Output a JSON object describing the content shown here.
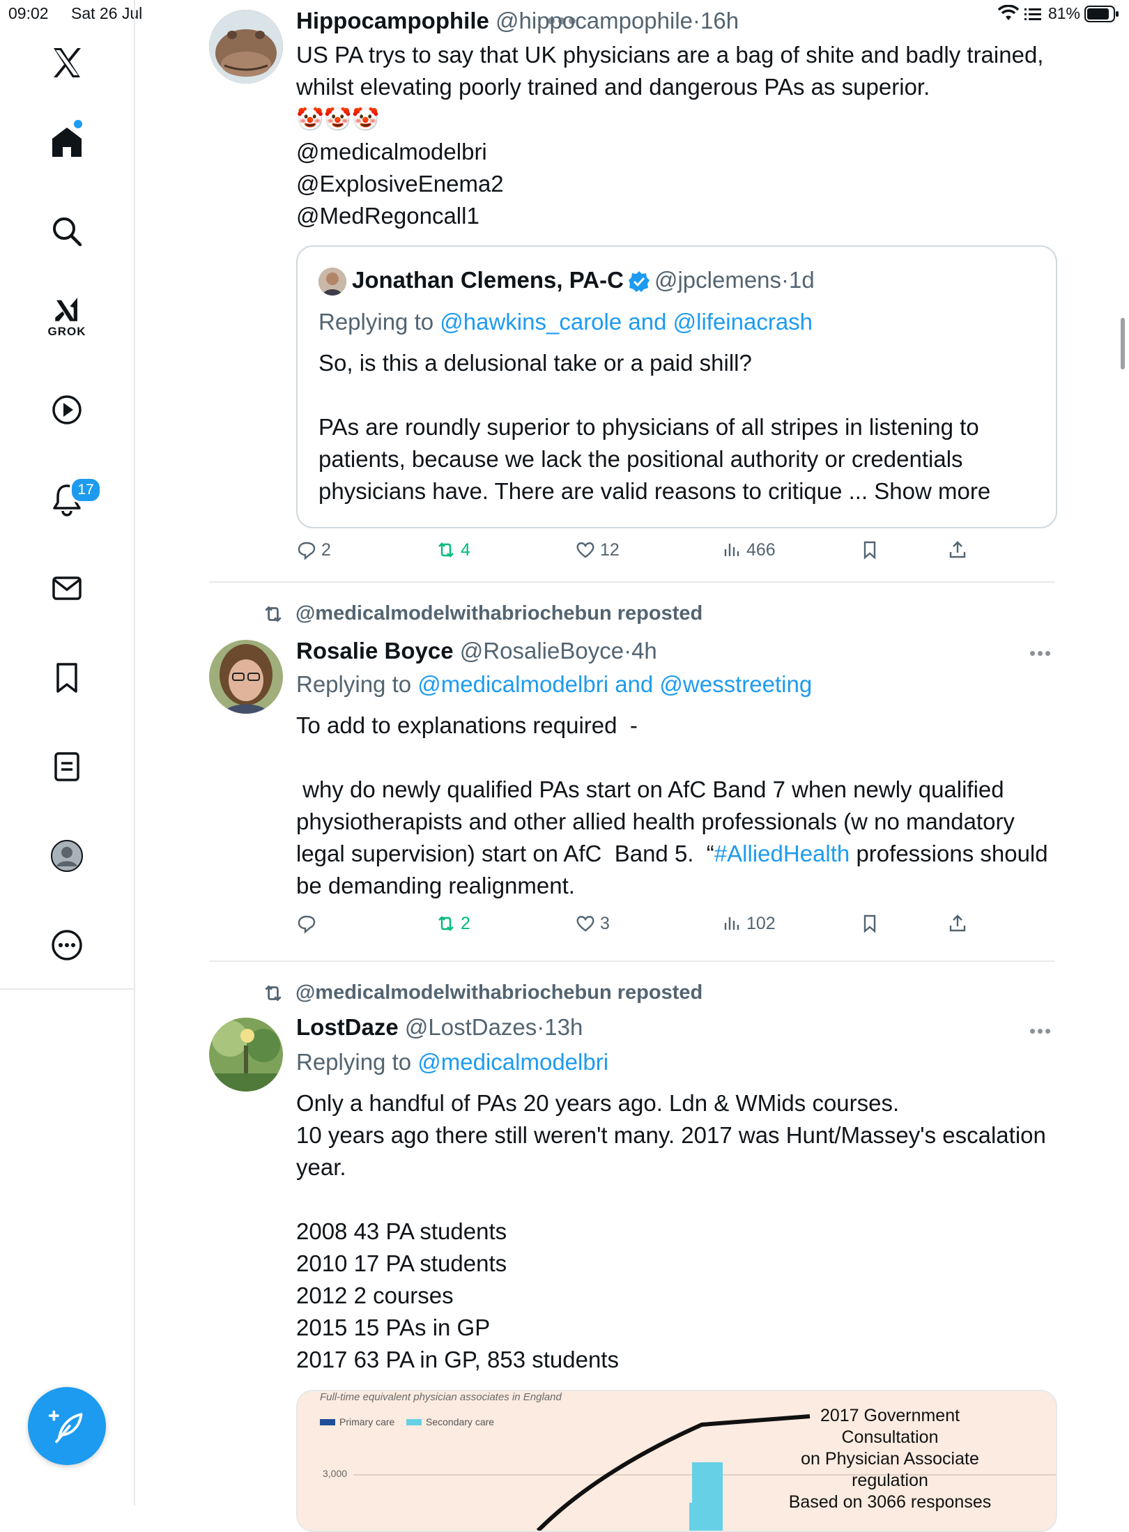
{
  "status_bar": {
    "time": "09:02",
    "date": "Sat 26 Jul",
    "battery": "81%"
  },
  "sidebar": {
    "items": [
      "x-logo",
      "home",
      "search",
      "grok",
      "video",
      "notifications",
      "messages",
      "bookmarks",
      "lists",
      "profile",
      "more"
    ],
    "grok_label": "GROK",
    "notification_count": "17"
  },
  "colors": {
    "accent": "#1d9bf0",
    "repost_green": "#00ba7c",
    "muted": "#536471",
    "text": "#0f1419"
  },
  "posts": [
    {
      "name": "Hippocampophile",
      "handle": "@hippocampophile",
      "time": "16h",
      "text": "US PA trys to say that UK physicians are a bag of shite and badly trained, whilst elevating poorly trained and dangerous PAs as superior.",
      "emoji": "🤡🤡🤡",
      "mentions": [
        "@medicalmodelbri",
        "@ExplosiveEnema2",
        "@MedRegoncall1"
      ],
      "quote": {
        "name": "Jonathan Clemens, PA-C",
        "handle": "@jpclemens",
        "time": "1d",
        "replying_prefix": "Replying to ",
        "replying_to": "@hawkins_carole and @lifeinacrash",
        "line1": "So, is this a delusional take or a paid shill?",
        "line2": "PAs are roundly superior to physicians of all stripes in listening to patients, because we lack the positional authority or credentials physicians have. There are valid reasons to critique ... Show more"
      },
      "stats": {
        "replies": "2",
        "reposts": "4",
        "likes": "12",
        "views": "466"
      }
    },
    {
      "reposted_by": "@medicalmodelwithabriochebun reposted",
      "name": "Rosalie Boyce",
      "handle": "@RosalieBoyce",
      "time": "4h",
      "replying_prefix": "Replying to ",
      "replying_to": "@medicalmodelbri and @wesstreeting",
      "line1": "To add to explanations required  -",
      "line2a": " why do newly qualified PAs start on AfC Band 7 when newly qualified physiotherapists and other allied health professionals (w no mandatory legal supervision) start on AfC  Band 5.  “",
      "hashtag": "#AlliedHealth",
      "line2b": " professions should be demanding realignment.",
      "stats": {
        "replies": "",
        "reposts": "2",
        "likes": "3",
        "views": "102"
      }
    },
    {
      "reposted_by": "@medicalmodelwithabriochebun reposted",
      "name": "LostDaze",
      "handle": "@LostDazes",
      "time": "13h",
      "replying_prefix": "Replying to ",
      "replying_to": "@medicalmodelbri",
      "para1": "Only a handful of PAs 20 years ago. Ldn & WMids courses.\n10 years ago there still weren't many. 2017 was Hunt/Massey's escalation year.",
      "list": [
        "2008 43 PA students",
        "2010 17 PA students",
        "2012 2 courses",
        "2015 15 PAs in GP",
        "2017 63 PA in GP, 853 students"
      ],
      "chart": {
        "title": "Full-time equivalent physician associates in England",
        "legend": [
          "Primary care",
          "Secondary care"
        ],
        "legend_colors": [
          "#1f4e99",
          "#66d0e6"
        ],
        "tick": "3,000",
        "annotation": [
          "2017 Government",
          "Consultation",
          "on Physician Associate",
          "regulation",
          "Based on 3066 responses"
        ]
      }
    }
  ]
}
